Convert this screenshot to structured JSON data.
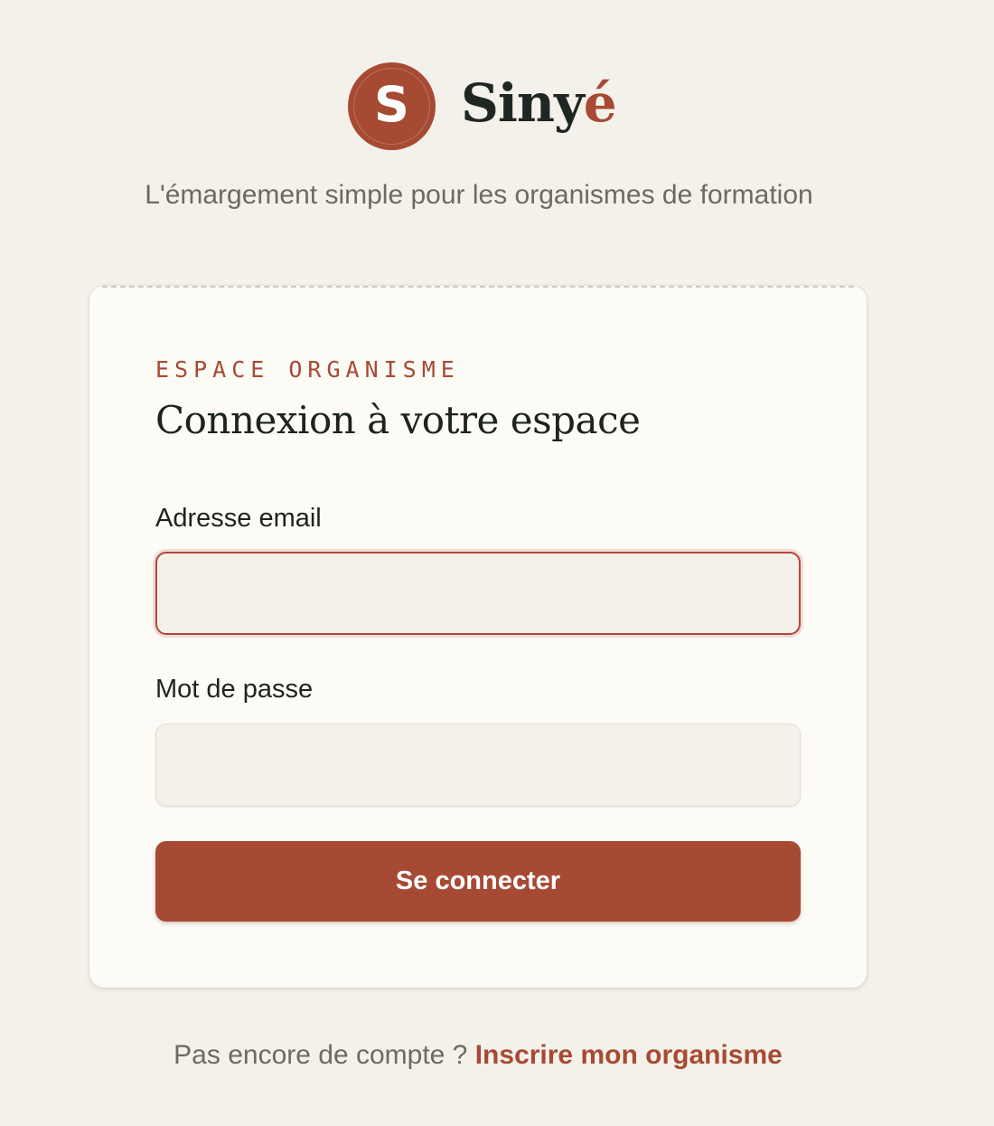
{
  "brand": {
    "logo_letter": "S",
    "name_prefix": "Siny",
    "name_accent": "é",
    "tagline": "L'émargement simple pour les organismes de formation"
  },
  "login": {
    "eyebrow": "ESPACE ORGANISME",
    "title": "Connexion à votre espace",
    "email_label": "Adresse email",
    "email_value": "",
    "password_label": "Mot de passe",
    "password_value": "",
    "submit_label": "Se connecter"
  },
  "footer": {
    "prompt": "Pas encore de compte ?",
    "link_label": "Inscrire mon organisme"
  },
  "colors": {
    "accent": "#a74a34",
    "background": "#f3f1ea",
    "card": "#fcfbf6",
    "text_dark": "#1f2320",
    "text_muted": "#6b6b63"
  },
  "icons": {
    "logo": "s-monogram-logo-icon"
  }
}
